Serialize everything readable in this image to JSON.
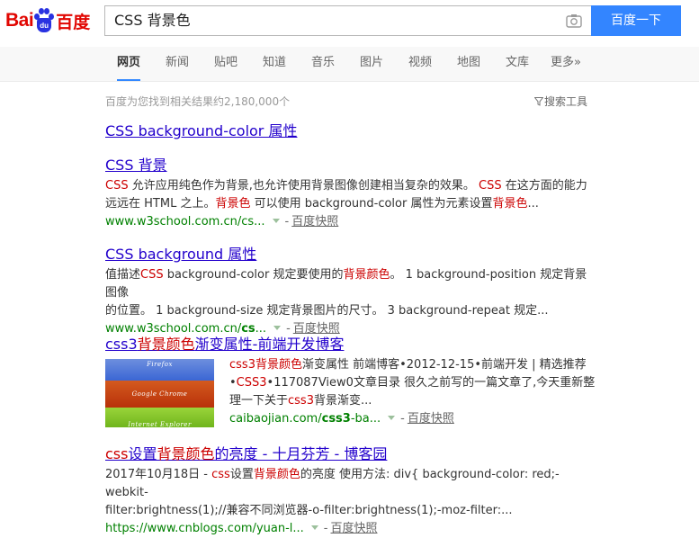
{
  "header": {
    "logo_text_en": "Bai",
    "logo_text_du": "du",
    "logo_text_cn": "百度",
    "search_value": "CSS 背景色",
    "search_button_label": "百度一下",
    "colors": {
      "brand_red": "#e10601",
      "brand_blue": "#2932e1",
      "button_blue": "#3385ff"
    }
  },
  "nav": {
    "tabs": [
      {
        "label": "网页",
        "active": true
      },
      {
        "label": "新闻"
      },
      {
        "label": "贴吧"
      },
      {
        "label": "知道"
      },
      {
        "label": "音乐"
      },
      {
        "label": "图片"
      },
      {
        "label": "视频"
      },
      {
        "label": "地图"
      },
      {
        "label": "文库"
      },
      {
        "label": "更多»"
      }
    ]
  },
  "results_meta": {
    "count_text": "百度为您找到相关结果约2,180,000个",
    "tools_label": "搜索工具"
  },
  "results": [
    {
      "title_a": "CSS background-color 属性"
    },
    {
      "title_a": "CSS 背景",
      "abstract_l1_a": "CSS",
      "abstract_l1_b": " 允许应用纯色作为背景,也允许使用背景图像创建相当复杂的效果。 ",
      "abstract_l1_c": "CSS",
      "abstract_l1_d": " 在这方面的能力",
      "abstract_l2_a": "远远在 HTML 之上。",
      "abstract_l2_b": "背景色",
      "abstract_l2_c": " 可以使用 background-color 属性为元素设置",
      "abstract_l2_d": "背景色",
      "abstract_l2_e": "...",
      "url": "www.w3school.com.cn/cs...",
      "snapshot": "百度快照"
    },
    {
      "title_a": "CSS background 属性",
      "abstract_l1_a": "值描述",
      "abstract_l1_b": "CSS",
      "abstract_l1_c": " background-color 规定要使用的",
      "abstract_l1_d": "背景颜色",
      "abstract_l1_e": "。 1 background-position 规定背景图像",
      "abstract_l2": "的位置。 1 background-size 规定背景图片的尺寸。 3 background-repeat 规定...",
      "url_a": "www.w3school.com.cn/",
      "url_b": "cs",
      "url_c": "...",
      "snapshot": "百度快照"
    },
    {
      "title_a": "css3",
      "title_b": "背景颜色",
      "title_c": "渐变属性-前端开发博客",
      "image_labels": [
        "Firefox",
        "Google Chrome",
        "Internet Explorer"
      ],
      "abstract_l1_a": "css3",
      "abstract_l1_b": "背景颜色",
      "abstract_l1_c": "渐变属性 前端博客•2012-12-15•前端开发 | 精选推荐",
      "abstract_l2_a": "•",
      "abstract_l2_b": "CSS3",
      "abstract_l2_c": "•117087View0文章目录 很久之前写的一篇文章了,今天重新整",
      "abstract_l3_a": "理一下关于",
      "abstract_l3_b": "css3",
      "abstract_l3_c": "背景渐变...",
      "url_a": "caibaojian.com/",
      "url_b": "css3",
      "url_c": "-ba...",
      "snapshot": "百度快照"
    },
    {
      "title_a": "css",
      "title_b": "设置",
      "title_c": "背景颜色",
      "title_d": "的亮度 - 十月芬芳 - 博客园",
      "abstract_l1_a": "2017年10月18日 - ",
      "abstract_l1_b": "css",
      "abstract_l1_c": "设置",
      "abstract_l1_d": "背景颜色",
      "abstract_l1_e": "的亮度 使用方法: div{ background-color: red;-webkit-",
      "abstract_l2": "filter:brightness(1);//兼容不同浏览器-o-filter:brightness(1);-moz-filter:...",
      "url": "https://www.cnblogs.com/yuan-l...",
      "snapshot": "百度快照"
    }
  ]
}
